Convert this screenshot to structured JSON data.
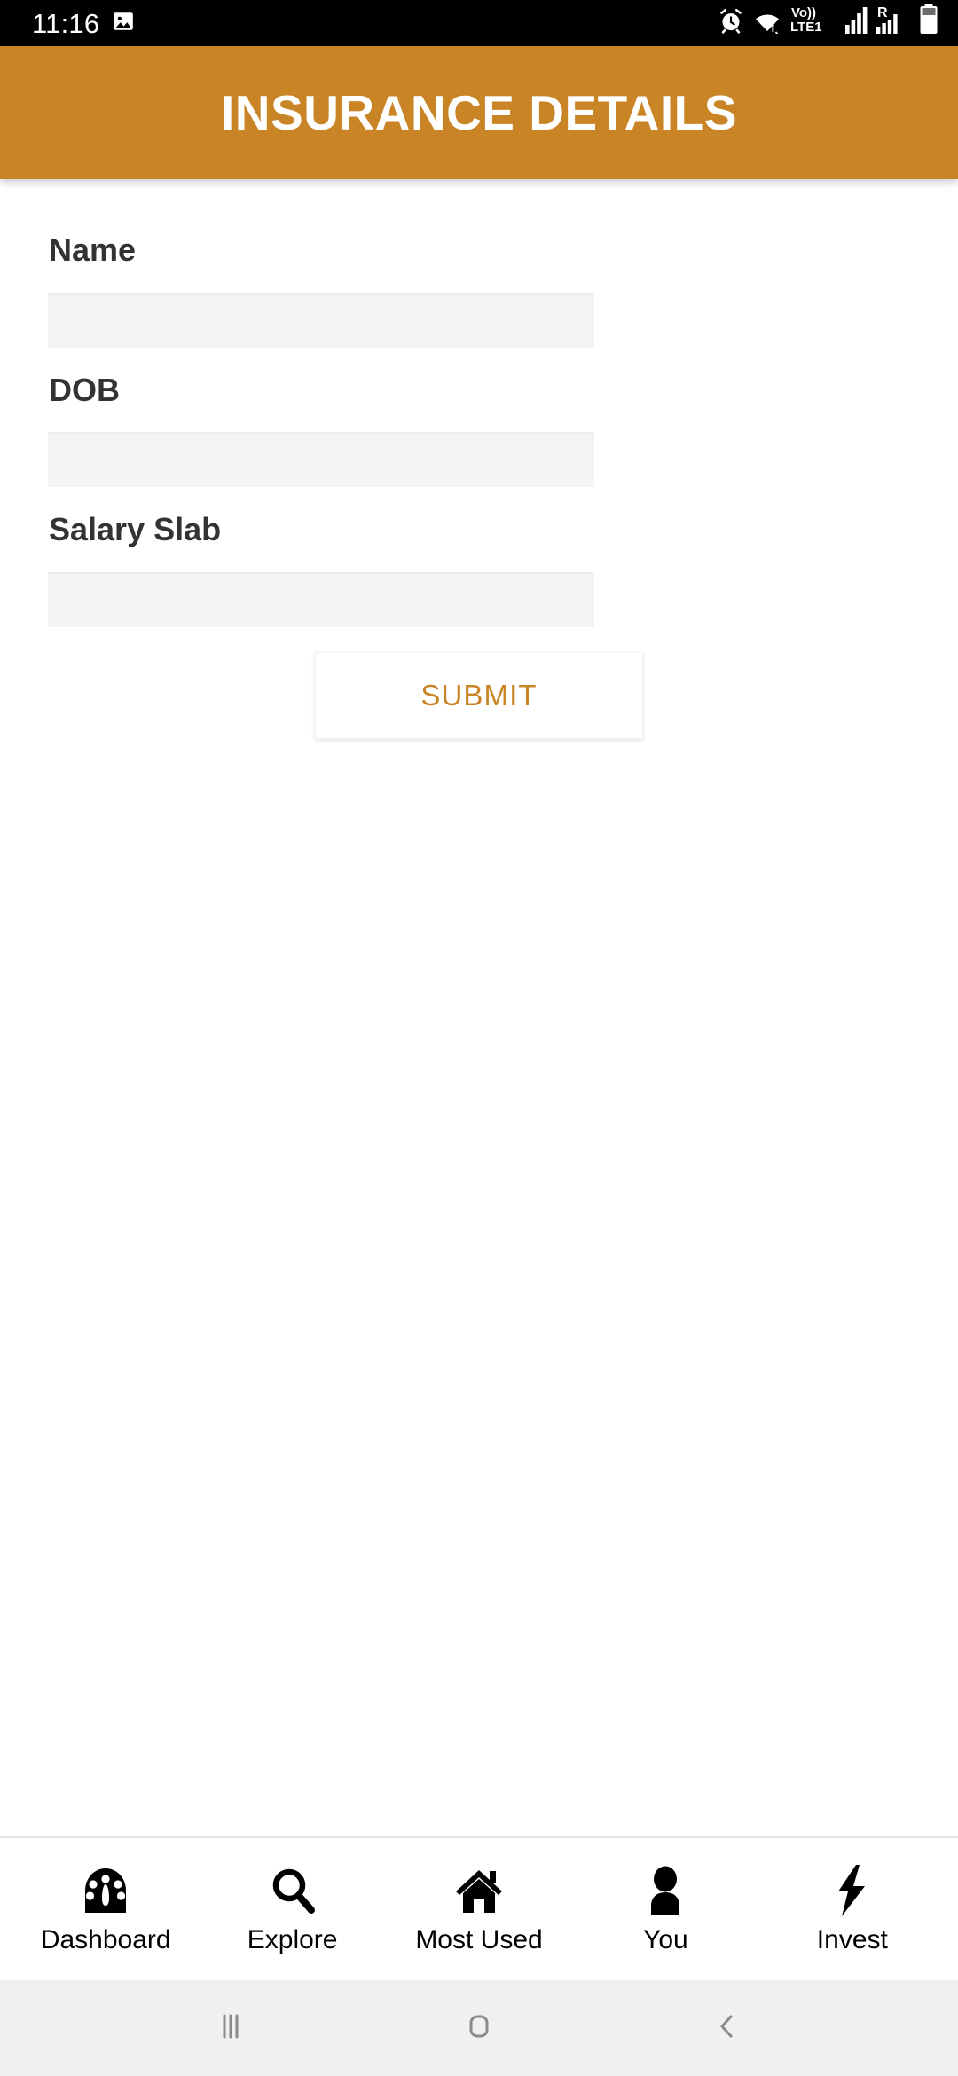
{
  "status_bar": {
    "time": "11:16",
    "left_icons": [
      {
        "name": "image-icon"
      }
    ],
    "right_icons": [
      {
        "name": "alarm-icon"
      },
      {
        "name": "wifi-icon"
      },
      {
        "name": "volte-icon",
        "label_top": "Vo))",
        "label_bottom": "LTE1"
      },
      {
        "name": "signal-bars-sim1-icon"
      },
      {
        "name": "roaming-icon",
        "label": "R"
      },
      {
        "name": "signal-bars-sim2-icon"
      },
      {
        "name": "battery-icon"
      }
    ]
  },
  "header": {
    "title": "INSURANCE DETAILS",
    "background_color": "#c98425",
    "text_color": "#ffffff"
  },
  "form": {
    "fields": [
      {
        "label": "Name",
        "value": "",
        "placeholder": ""
      },
      {
        "label": "DOB",
        "value": "",
        "placeholder": ""
      },
      {
        "label": "Salary Slab",
        "value": "",
        "placeholder": ""
      }
    ],
    "submit_label": "SUBMIT",
    "submit_text_color": "#c98425"
  },
  "tab_bar": {
    "items": [
      {
        "label": "Dashboard",
        "icon": "speedometer-icon"
      },
      {
        "label": "Explore",
        "icon": "search-icon"
      },
      {
        "label": "Most Used",
        "icon": "home-icon"
      },
      {
        "label": "You",
        "icon": "person-icon"
      },
      {
        "label": "Invest",
        "icon": "lightning-bolt-icon"
      }
    ]
  },
  "system_nav": {
    "buttons": [
      {
        "name": "recents-button",
        "icon": "recents-icon"
      },
      {
        "name": "home-button",
        "icon": "home-square-icon"
      },
      {
        "name": "back-button",
        "icon": "back-chevron-icon"
      }
    ]
  }
}
